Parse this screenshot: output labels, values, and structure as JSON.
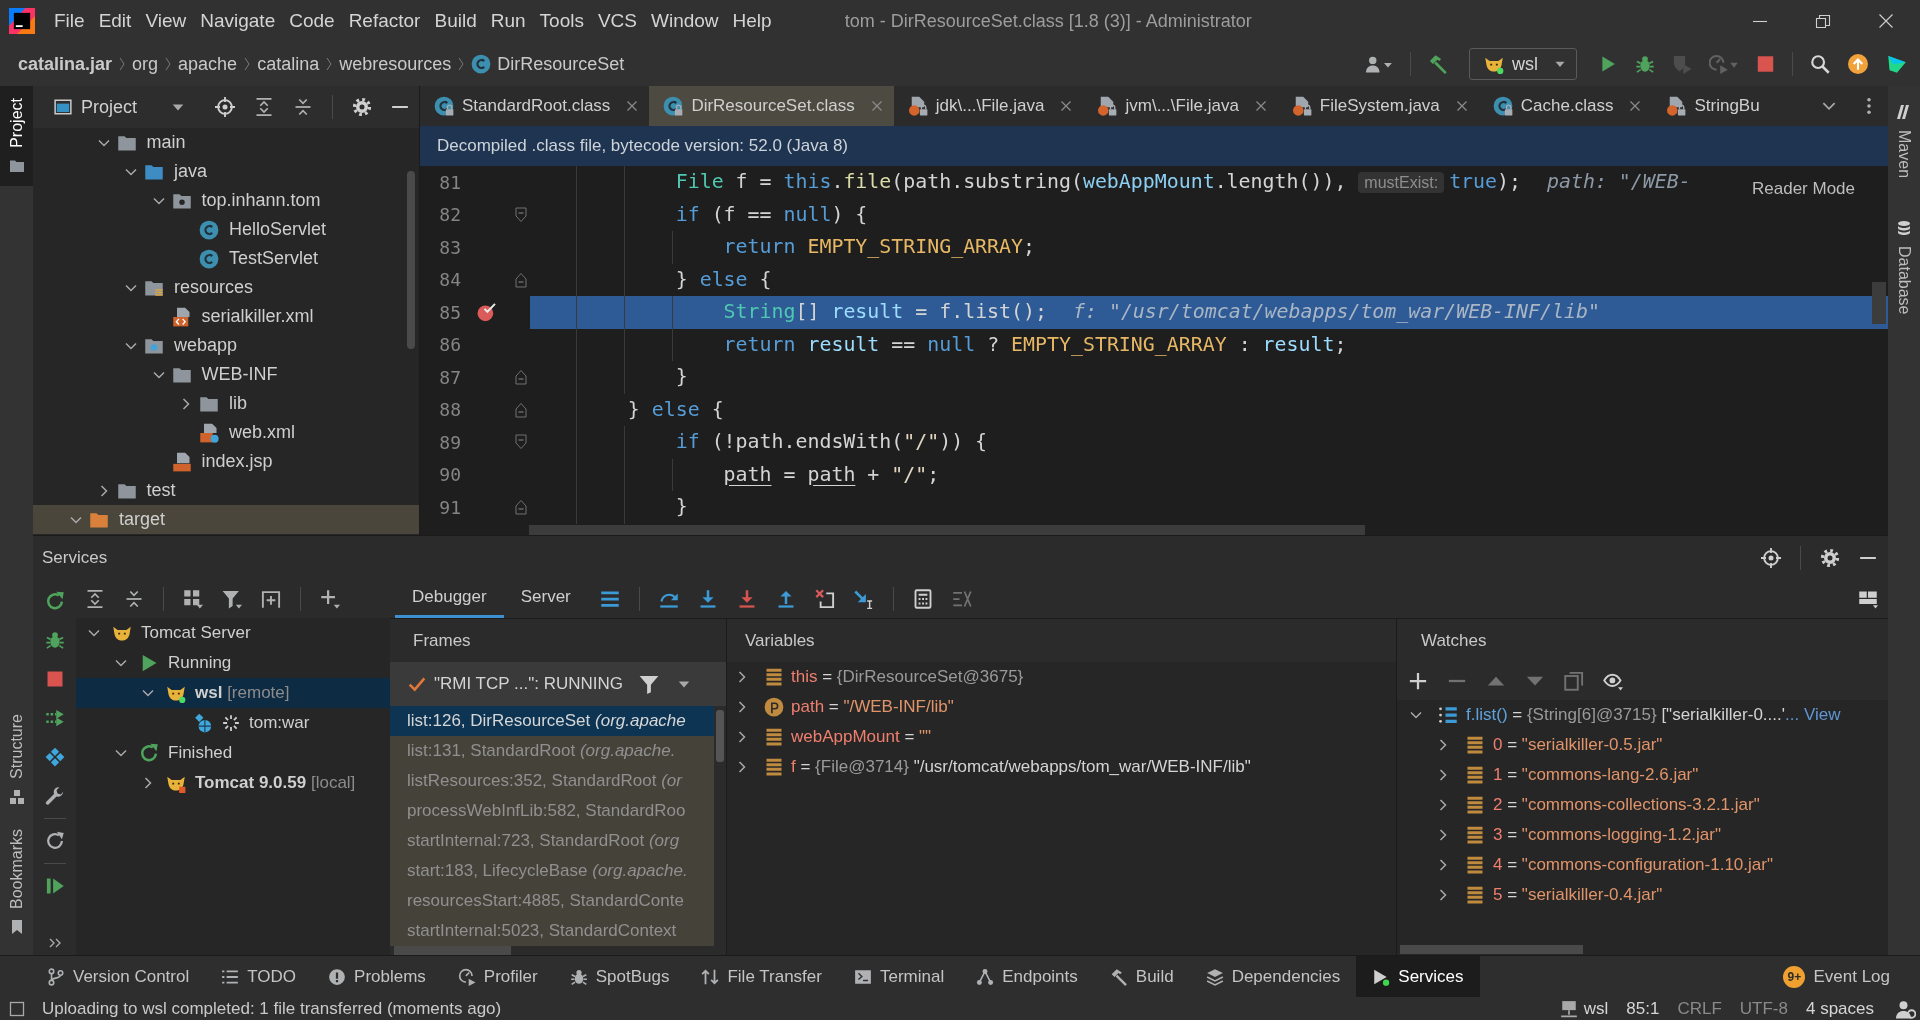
{
  "window": {
    "title": "tom - DirResourceSet.class [1.8 (3)] - Administrator",
    "menu": [
      "File",
      "Edit",
      "View",
      "Navigate",
      "Code",
      "Refactor",
      "Build",
      "Run",
      "Tools",
      "VCS",
      "Window",
      "Help"
    ]
  },
  "navigation": {
    "breadcrumbs": [
      {
        "label": "catalina.jar",
        "kind": "jar"
      },
      {
        "label": "org",
        "kind": "package"
      },
      {
        "label": "apache",
        "kind": "package"
      },
      {
        "label": "catalina",
        "kind": "package"
      },
      {
        "label": "webresources",
        "kind": "package"
      },
      {
        "label": "DirResourceSet",
        "kind": "class"
      }
    ],
    "toolbar": [
      [
        {
          "kind": "user",
          "disabled": false
        }
      ],
      [
        {
          "kind": "build",
          "disabled": false
        },
        {
          "kind": "run_config",
          "label": "wsl",
          "disabled": false
        },
        {
          "kind": "run",
          "disabled": false
        },
        {
          "kind": "debug",
          "disabled": false
        },
        {
          "kind": "coverage",
          "disabled": true
        },
        {
          "kind": "profile",
          "disabled": true
        },
        {
          "kind": "stop",
          "disabled": false
        }
      ],
      [
        {
          "kind": "search",
          "disabled": false
        },
        {
          "kind": "update",
          "disabled": false
        },
        {
          "kind": "toolbox",
          "disabled": false
        }
      ]
    ]
  },
  "left_stripe": {
    "top": [
      {
        "label": "Project",
        "selected": true
      }
    ],
    "bottom": [
      {
        "label": "Structure",
        "selected": false
      },
      {
        "label": "Bookmarks",
        "selected": false
      }
    ]
  },
  "right_stripe": [
    {
      "label": "Maven",
      "kind": "maven",
      "selected": false
    },
    {
      "label": "Database",
      "kind": "database",
      "selected": false
    }
  ],
  "project": {
    "title": "Project",
    "tree": [
      {
        "children": [
          {
            "label": "main",
            "kind": "folder",
            "expanded": true,
            "children": [
              {
                "label": "java",
                "kind": "source-root",
                "expanded": true,
                "children": [
                  {
                    "label": "top.inhann.tom",
                    "kind": "package",
                    "expanded": true,
                    "children": [
                      {
                        "label": "HelloServlet",
                        "kind": "class"
                      },
                      {
                        "label": "TestServlet",
                        "kind": "class"
                      }
                    ]
                  }
                ]
              },
              {
                "label": "resources",
                "kind": "resources-root",
                "expanded": true,
                "children": [
                  {
                    "label": "serialkiller.xml",
                    "kind": "xml"
                  }
                ]
              },
              {
                "label": "webapp",
                "kind": "web-root",
                "expanded": true,
                "children": [
                  {
                    "label": "WEB-INF",
                    "kind": "folder",
                    "expanded": true,
                    "children": [
                      {
                        "label": "lib",
                        "kind": "folder",
                        "expanded": false
                      },
                      {
                        "label": "web.xml",
                        "kind": "web-xml"
                      }
                    ]
                  },
                  {
                    "label": "index.jsp",
                    "kind": "jsp"
                  }
                ]
              }
            ]
          },
          {
            "label": "test",
            "kind": "folder",
            "expanded": false
          }
        ]
      },
      {
        "label": "target",
        "kind": "excluded",
        "expanded": true
      }
    ]
  },
  "editor": {
    "tabs": [
      {
        "label": "StandardRoot.class",
        "kind": "class",
        "selected": false,
        "closable": true
      },
      {
        "label": "DirResourceSet.class",
        "kind": "class",
        "selected": true,
        "closable": true
      },
      {
        "label": "jdk\\...\\File.java",
        "kind": "java",
        "selected": false,
        "closable": true
      },
      {
        "label": "jvm\\...\\File.java",
        "kind": "java",
        "selected": false,
        "closable": true
      },
      {
        "label": "FileSystem.java",
        "kind": "java",
        "selected": false,
        "closable": true
      },
      {
        "label": "Cache.class",
        "kind": "class",
        "selected": false,
        "closable": true
      },
      {
        "label": "StringBu",
        "kind": "java",
        "selected": false,
        "closable": false
      }
    ],
    "banner": "Decompiled .class file, bytecode version: 52.0 (Java 8)",
    "reader_mode": "Reader Mode",
    "lines": [
      {
        "number": "81",
        "current": false,
        "breakpoint": false,
        "fold_start": false,
        "fold_end": false,
        "tokens": [
          {
            "text": "            File",
            "kind": "type"
          },
          {
            "text": " f = ",
            "kind": "plain"
          },
          {
            "text": "this",
            "kind": "keyword"
          },
          {
            "text": ".",
            "kind": "plain"
          },
          {
            "text": "file",
            "kind": "method"
          },
          {
            "text": "(path.substring(",
            "kind": "plain"
          },
          {
            "text": "webAppMount",
            "kind": "field"
          },
          {
            "text": ".length()), ",
            "kind": "plain"
          },
          {
            "text": "mustExist:",
            "kind": "param_hint"
          },
          {
            "text": "true",
            "kind": "keyword"
          },
          {
            "text": ");",
            "kind": "plain"
          },
          {
            "text": "path: \"/WEB-",
            "kind": "inline_value"
          }
        ]
      },
      {
        "number": "82",
        "current": false,
        "breakpoint": false,
        "fold_start": true,
        "fold_end": false,
        "tokens": [
          {
            "text": "            if",
            "kind": "keyword"
          },
          {
            "text": " (f == ",
            "kind": "plain"
          },
          {
            "text": "null",
            "kind": "keyword"
          },
          {
            "text": ") {",
            "kind": "plain"
          }
        ]
      },
      {
        "number": "83",
        "current": false,
        "breakpoint": false,
        "fold_start": false,
        "fold_end": false,
        "tokens": [
          {
            "text": "                return",
            "kind": "keyword"
          },
          {
            "text": " EMPTY_STRING_ARRAY",
            "kind": "constant"
          },
          {
            "text": ";",
            "kind": "plain"
          }
        ]
      },
      {
        "number": "84",
        "current": false,
        "breakpoint": false,
        "fold_start": false,
        "fold_end": true,
        "tokens": [
          {
            "text": "            } ",
            "kind": "plain"
          },
          {
            "text": "else",
            "kind": "keyword"
          },
          {
            "text": " {",
            "kind": "plain"
          }
        ]
      },
      {
        "number": "85",
        "current": true,
        "breakpoint": true,
        "fold_start": false,
        "fold_end": false,
        "tokens": [
          {
            "text": "                String",
            "kind": "type"
          },
          {
            "text": "[] ",
            "kind": "plain"
          },
          {
            "text": "result",
            "kind": "local"
          },
          {
            "text": " = f.list();",
            "kind": "plain"
          },
          {
            "text": "f: \"/usr/tomcat/webapps/tom_war/WEB-INF/lib\"",
            "kind": "inline_value"
          }
        ]
      },
      {
        "number": "86",
        "current": false,
        "breakpoint": false,
        "fold_start": false,
        "fold_end": false,
        "tokens": [
          {
            "text": "                return",
            "kind": "keyword"
          },
          {
            "text": " result",
            "kind": "local"
          },
          {
            "text": " == ",
            "kind": "plain"
          },
          {
            "text": "null",
            "kind": "keyword"
          },
          {
            "text": " ? ",
            "kind": "plain"
          },
          {
            "text": "EMPTY_STRING_ARRAY",
            "kind": "constant"
          },
          {
            "text": " : ",
            "kind": "plain"
          },
          {
            "text": "result",
            "kind": "local"
          },
          {
            "text": ";",
            "kind": "plain"
          }
        ]
      },
      {
        "number": "87",
        "current": false,
        "breakpoint": false,
        "fold_start": false,
        "fold_end": true,
        "tokens": [
          {
            "text": "            }",
            "kind": "plain"
          }
        ]
      },
      {
        "number": "88",
        "current": false,
        "breakpoint": false,
        "fold_start": false,
        "fold_end": true,
        "tokens": [
          {
            "text": "        } ",
            "kind": "plain"
          },
          {
            "text": "else",
            "kind": "keyword"
          },
          {
            "text": " {",
            "kind": "plain"
          }
        ]
      },
      {
        "number": "89",
        "current": false,
        "breakpoint": false,
        "fold_start": true,
        "fold_end": false,
        "tokens": [
          {
            "text": "            if",
            "kind": "keyword"
          },
          {
            "text": " (!path.endsWith(",
            "kind": "plain"
          },
          {
            "text": "\"/\"",
            "kind": "string"
          },
          {
            "text": ")) {",
            "kind": "plain"
          }
        ]
      },
      {
        "number": "90",
        "current": false,
        "breakpoint": false,
        "fold_start": false,
        "fold_end": false,
        "tokens": [
          {
            "text": "                path",
            "kind": "reassigned"
          },
          {
            "text": " = ",
            "kind": "plain"
          },
          {
            "text": "path",
            "kind": "reassigned"
          },
          {
            "text": " + ",
            "kind": "plain"
          },
          {
            "text": "\"/\"",
            "kind": "string"
          },
          {
            "text": ";",
            "kind": "plain"
          }
        ]
      },
      {
        "number": "91",
        "current": false,
        "breakpoint": false,
        "fold_start": false,
        "fold_end": true,
        "tokens": [
          {
            "text": "            }",
            "kind": "plain"
          }
        ]
      }
    ]
  },
  "services": {
    "title": "Services",
    "tree": [
      {
        "label": "Tomcat Server",
        "kind": "server",
        "expanded": true,
        "selected": false,
        "children": [
          {
            "label": "Running",
            "kind": "running",
            "expanded": true,
            "selected": false,
            "children": [
              {
                "label": "wsl",
                "note": "[remote]",
                "kind": "config-running",
                "expanded": true,
                "selected": true,
                "children": [
                  {
                    "label": "tom:war",
                    "kind": "artifact",
                    "selected": false
                  }
                ]
              }
            ]
          },
          {
            "label": "Finished",
            "kind": "finished",
            "expanded": true,
            "selected": false,
            "children": [
              {
                "label": "Tomcat 9.0.59",
                "note": "[local]",
                "kind": "config-stopped",
                "expanded": false,
                "selected": false
              }
            ]
          }
        ]
      }
    ],
    "debugger": {
      "tabs": [
        {
          "label": "Debugger",
          "selected": true
        },
        {
          "label": "Server",
          "selected": false
        }
      ],
      "toolbar": [
        [
          {
            "kind": "threads",
            "disabled": false
          }
        ],
        [
          {
            "kind": "step_over",
            "disabled": false
          },
          {
            "kind": "step_into",
            "disabled": false
          },
          {
            "kind": "force_step_into",
            "disabled": false
          },
          {
            "kind": "step_out",
            "disabled": false
          },
          {
            "kind": "drop_frame",
            "disabled": false
          },
          {
            "kind": "run_to_cursor",
            "disabled": false
          }
        ],
        [
          {
            "kind": "evaluate",
            "disabled": false
          },
          {
            "kind": "trace",
            "disabled": true
          }
        ]
      ],
      "frames": {
        "title": "Frames",
        "thread": "\"RMI TCP ...\": RUNNING",
        "items": [
          {
            "location": "list:126, DirResourceSet",
            "package": "(org.apache",
            "selected": true
          },
          {
            "location": "list:131, StandardRoot",
            "package": "(org.apache.",
            "selected": false
          },
          {
            "location": "listResources:352, StandardRoot",
            "package": "(or",
            "selected": false
          },
          {
            "location": "processWebInfLib:582, StandardRoo",
            "selected": false
          },
          {
            "location": "startInternal:723, StandardRoot",
            "package": "(org",
            "selected": false
          },
          {
            "location": "start:183, LifecycleBase",
            "package": "(org.apache.",
            "selected": false
          },
          {
            "location": "resourcesStart:4885, StandardConte",
            "selected": false
          },
          {
            "location": "startInternal:5023, StandardContext",
            "selected": false
          }
        ]
      },
      "variables": {
        "title": "Variables",
        "items": [
          {
            "kind": "field",
            "expanded": false,
            "parts": [
              {
                "text": "this",
                "kind": "name"
              },
              {
                "text": " = ",
                "kind": "plain"
              },
              {
                "text": "{DirResourceSet@3675}",
                "kind": "ref"
              }
            ]
          },
          {
            "kind": "param",
            "expanded": false,
            "parts": [
              {
                "text": "path",
                "kind": "name"
              },
              {
                "text": " = ",
                "kind": "plain"
              },
              {
                "text": "\"/WEB-INF/lib\"",
                "kind": "string"
              }
            ]
          },
          {
            "kind": "field",
            "expanded": false,
            "parts": [
              {
                "text": "webAppMount",
                "kind": "name"
              },
              {
                "text": " = ",
                "kind": "plain"
              },
              {
                "text": "\"\"",
                "kind": "string"
              }
            ]
          },
          {
            "kind": "field",
            "expanded": false,
            "parts": [
              {
                "text": "f",
                "kind": "name"
              },
              {
                "text": " = ",
                "kind": "plain"
              },
              {
                "text": "{File@3714}",
                "kind": "ref"
              },
              {
                "text": " \"/usr/tomcat/webapps/tom_war/WEB-INF/lib\"",
                "kind": "text"
              }
            ]
          }
        ]
      },
      "watches": {
        "title": "Watches",
        "toolbar": [
          {
            "kind": "add",
            "disabled": false
          },
          {
            "kind": "remove",
            "disabled": true
          },
          {
            "kind": "up",
            "disabled": true
          },
          {
            "kind": "down",
            "disabled": true
          },
          {
            "kind": "copy",
            "disabled": true
          },
          {
            "kind": "view_options",
            "disabled": false
          }
        ],
        "items": [
          {
            "kind": "array",
            "expanded": true,
            "parts": [
              {
                "text": "f.list()",
                "kind": "expression"
              },
              {
                "text": " = ",
                "kind": "plain"
              },
              {
                "text": "{String[6]@3715}",
                "kind": "ref"
              },
              {
                "text": " [\"serialkiller-0....'",
                "kind": "text"
              },
              {
                "text": "... View",
                "kind": "link"
              }
            ],
            "children": [
              {
                "kind": "field",
                "expanded": false,
                "parts": [
                  {
                    "text": "0",
                    "kind": "index"
                  },
                  {
                    "text": " = ",
                    "kind": "plain"
                  },
                  {
                    "text": "\"serialkiller-0.5.jar\"",
                    "kind": "string"
                  }
                ]
              },
              {
                "kind": "field",
                "expanded": false,
                "parts": [
                  {
                    "text": "1",
                    "kind": "index"
                  },
                  {
                    "text": " = ",
                    "kind": "plain"
                  },
                  {
                    "text": "\"commons-lang-2.6.jar\"",
                    "kind": "string"
                  }
                ]
              },
              {
                "kind": "field",
                "expanded": false,
                "parts": [
                  {
                    "text": "2",
                    "kind": "index"
                  },
                  {
                    "text": " = ",
                    "kind": "plain"
                  },
                  {
                    "text": "\"commons-collections-3.2.1.jar\"",
                    "kind": "string"
                  }
                ]
              },
              {
                "kind": "field",
                "expanded": false,
                "parts": [
                  {
                    "text": "3",
                    "kind": "index"
                  },
                  {
                    "text": " = ",
                    "kind": "plain"
                  },
                  {
                    "text": "\"commons-logging-1.2.jar\"",
                    "kind": "string"
                  }
                ]
              },
              {
                "kind": "field",
                "expanded": false,
                "parts": [
                  {
                    "text": "4",
                    "kind": "index"
                  },
                  {
                    "text": " = ",
                    "kind": "plain"
                  },
                  {
                    "text": "\"commons-configuration-1.10.jar\"",
                    "kind": "string"
                  }
                ]
              },
              {
                "kind": "field",
                "expanded": false,
                "parts": [
                  {
                    "text": "5",
                    "kind": "index"
                  },
                  {
                    "text": " = ",
                    "kind": "plain"
                  },
                  {
                    "text": "\"serialkiller-0.4.jar\"",
                    "kind": "string"
                  }
                ]
              }
            ]
          }
        ]
      }
    }
  },
  "tool_windows": {
    "items": [
      {
        "label": "Version Control",
        "selected": false
      },
      {
        "label": "TODO",
        "selected": false
      },
      {
        "label": "Problems",
        "selected": false
      },
      {
        "label": "Profiler",
        "selected": false
      },
      {
        "label": "SpotBugs",
        "selected": false
      },
      {
        "label": "File Transfer",
        "selected": false
      },
      {
        "label": "Terminal",
        "selected": false
      },
      {
        "label": "Endpoints",
        "selected": false
      },
      {
        "label": "Build",
        "selected": false
      },
      {
        "label": "Dependencies",
        "selected": false
      },
      {
        "label": "Services",
        "selected": true
      }
    ],
    "event_log": {
      "label": "Event Log",
      "badge": "9+"
    }
  },
  "status_bar": {
    "message": "Uploading to wsl completed: 1 file transferred (moments ago)",
    "widgets": [
      {
        "label": "wsl",
        "kind": "connection",
        "disabled": false
      },
      {
        "label": "85:1",
        "kind": "text",
        "disabled": false
      },
      {
        "label": "CRLF",
        "kind": "text",
        "disabled": true
      },
      {
        "label": "UTF-8",
        "kind": "text",
        "disabled": true
      },
      {
        "label": "4 spaces",
        "kind": "text",
        "disabled": false
      }
    ]
  }
}
